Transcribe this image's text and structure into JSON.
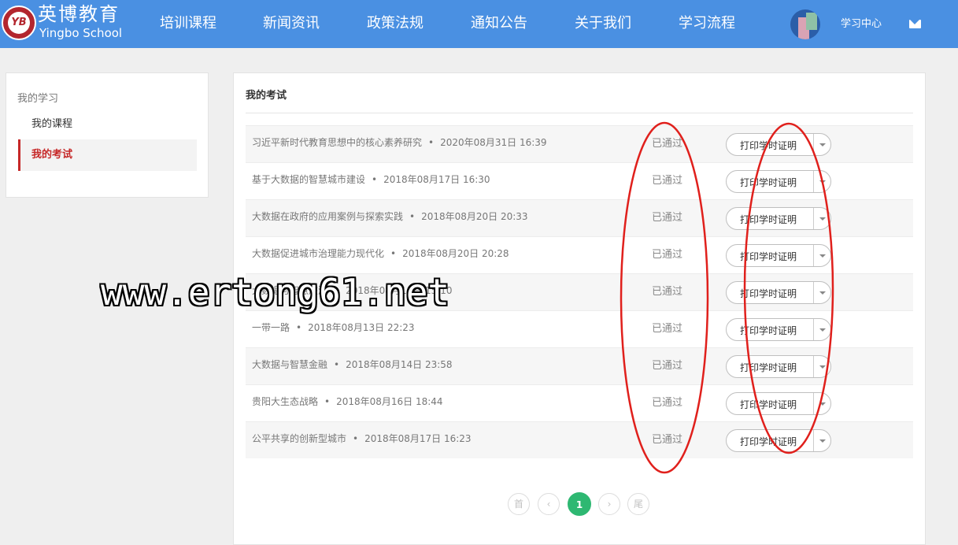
{
  "header": {
    "logo_cn": "英博教育",
    "logo_en": "Yingbo School",
    "logo_mark": "YB",
    "nav": [
      "培训课程",
      "新闻资讯",
      "政策法规",
      "通知公告",
      "关于我们",
      "学习流程"
    ],
    "user_center": "学习中心"
  },
  "sidebar": {
    "title": "我的学习",
    "items": [
      {
        "label": "我的课程",
        "active": false
      },
      {
        "label": "我的考试",
        "active": true
      }
    ]
  },
  "main": {
    "title": "我的考试",
    "exams": [
      {
        "name": "习近平新时代教育思想中的核心素养研究",
        "time": "2020年08月31日 16:39",
        "status": "已通过",
        "action": "打印学时证明"
      },
      {
        "name": "基于大数据的智慧城市建设",
        "time": "2018年08月17日 16:30",
        "status": "已通过",
        "action": "打印学时证明"
      },
      {
        "name": "大数据在政府的应用案例与探索实践",
        "time": "2018年08月20日 20:33",
        "status": "已通过",
        "action": "打印学时证明"
      },
      {
        "name": "大数据促进城市治理能力现代化",
        "time": "2018年08月20日 20:28",
        "status": "已通过",
        "action": "打印学时证明"
      },
      {
        "name": "大数据与智慧旅游",
        "time": "2018年08月14日 15:10",
        "status": "已通过",
        "action": "打印学时证明"
      },
      {
        "name": "一带一路",
        "time": "2018年08月13日 22:23",
        "status": "已通过",
        "action": "打印学时证明"
      },
      {
        "name": "大数据与智慧金融",
        "time": "2018年08月14日 23:58",
        "status": "已通过",
        "action": "打印学时证明"
      },
      {
        "name": "贵阳大生态战略",
        "time": "2018年08月16日 18:44",
        "status": "已通过",
        "action": "打印学时证明"
      },
      {
        "name": "公平共享的创新型城市",
        "time": "2018年08月17日 16:23",
        "status": "已通过",
        "action": "打印学时证明"
      }
    ],
    "pagination": {
      "first": "首",
      "prev": "‹",
      "current": "1",
      "next": "›",
      "last": "尾"
    }
  },
  "watermark": "www.ertong61.net",
  "colors": {
    "header": "#4a90e2",
    "active": "#c62828",
    "page_active": "#2eb872",
    "annotation": "#e0201c"
  }
}
